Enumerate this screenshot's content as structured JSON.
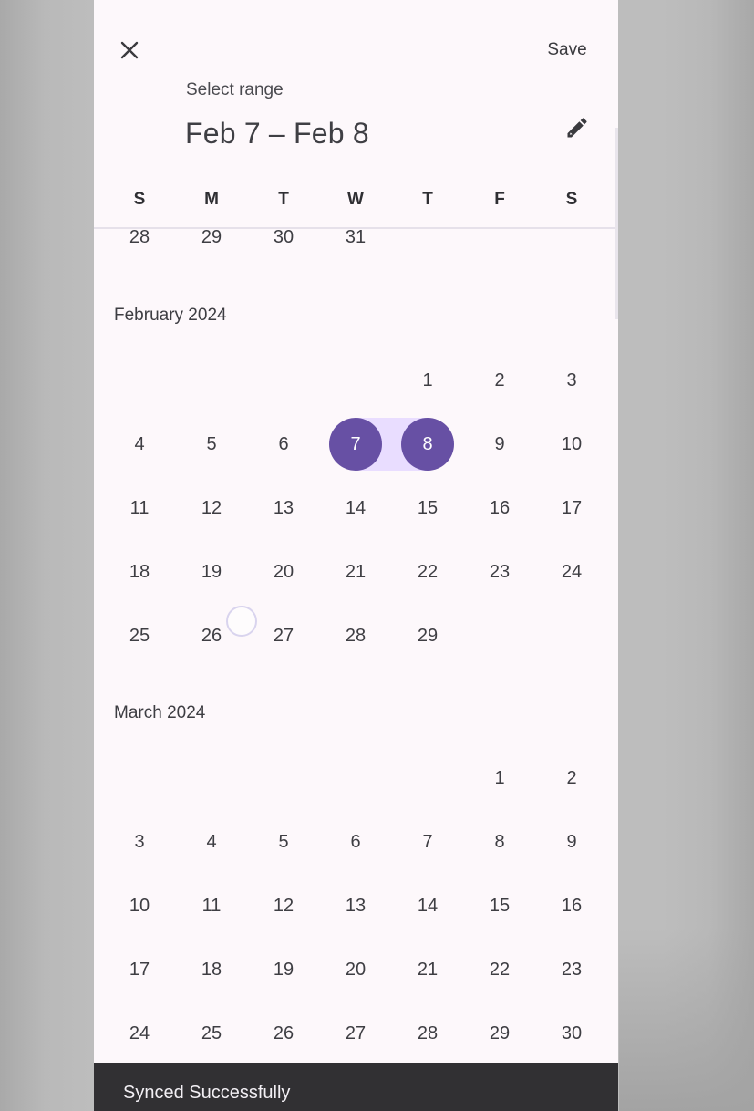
{
  "header": {
    "close_icon": "close-icon",
    "save_label": "Save",
    "range_label": "Select range",
    "range_value": "Feb 7 – Feb 8",
    "edit_icon": "pencil-icon"
  },
  "weekdays": [
    "S",
    "M",
    "T",
    "W",
    "T",
    "F",
    "S"
  ],
  "months": [
    {
      "label": "",
      "days": [
        "28",
        "29",
        "30",
        "31"
      ]
    },
    {
      "label": "February 2024",
      "days": [
        "1",
        "2",
        "3",
        "4",
        "5",
        "6",
        "7",
        "8",
        "9",
        "10",
        "11",
        "12",
        "13",
        "14",
        "15",
        "16",
        "17",
        "18",
        "19",
        "20",
        "21",
        "22",
        "23",
        "24",
        "25",
        "26",
        "27",
        "28",
        "29"
      ]
    },
    {
      "label": "March 2024",
      "days": [
        "1",
        "2",
        "3",
        "4",
        "5",
        "6",
        "7",
        "8",
        "9",
        "10",
        "11",
        "12",
        "13",
        "14",
        "15",
        "16",
        "17",
        "18",
        "19",
        "20",
        "21",
        "22",
        "23",
        "24",
        "25",
        "26",
        "27",
        "28",
        "29",
        "30"
      ]
    }
  ],
  "selection": {
    "start": "7",
    "end": "8",
    "month": "February 2024"
  },
  "snackbar": {
    "text": "Synced Successfully"
  },
  "colors": {
    "accent": "#6750a4",
    "range_fill": "#e9ddff",
    "surface": "#fdf8fb",
    "snackbar": "#313033"
  }
}
